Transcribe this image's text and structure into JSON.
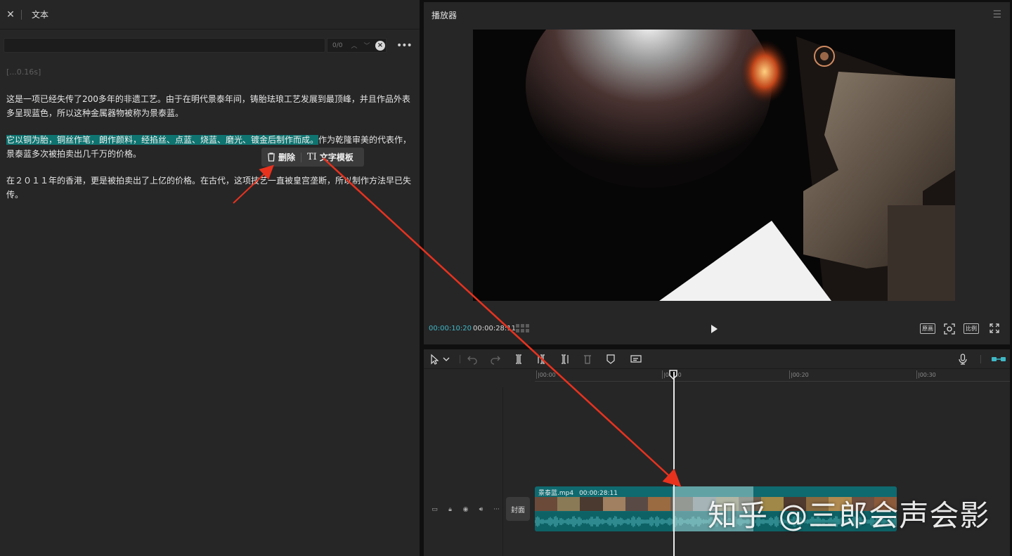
{
  "text_panel": {
    "title": "文本",
    "search": {
      "value": "",
      "count": "0/0"
    },
    "timestamp": "[...0.16s]",
    "paragraphs": [
      "这是一项已经失传了200多年的非遗工艺。由于在明代景泰年间，铸胎珐琅工艺发展到最顶峰，并且作品外表多呈现蓝色，所以这种金属器物被称为景泰蓝。",
      "作为乾隆审美的代表作，景泰蓝多次被拍卖出几千万的价格。",
      "在２０１１年的香港，更是被拍卖出了上亿的价格。在古代，这项技艺一直被皇宫垄断，所以制作方法早已失传。"
    ],
    "highlighted": "它以铜为胎，铜丝作笔，朗作颜料，经掐丝、点蓝、烧蓝、磨光、镀金后制作而成。",
    "popup": {
      "delete_label": "删除",
      "template_label": "文字模板"
    }
  },
  "player": {
    "title": "播放器",
    "current_time": "00:00:10:20",
    "total_time": "00:00:28:11",
    "buttons": {
      "original": "原画",
      "ratio": "比例"
    }
  },
  "timeline": {
    "ruler": [
      "|00:00",
      "|00:10",
      "|00:20",
      "|00:30"
    ],
    "cover_label": "封面",
    "clip": {
      "name": "景泰蓝.mp4",
      "duration": "00:00:28:11"
    }
  },
  "watermark": "知乎 @三郎会声会影",
  "colors": {
    "accent": "#3fb8c6",
    "highlight": "#0f7470",
    "clip": "#0e6a6f",
    "arrow": "#e8321e"
  }
}
